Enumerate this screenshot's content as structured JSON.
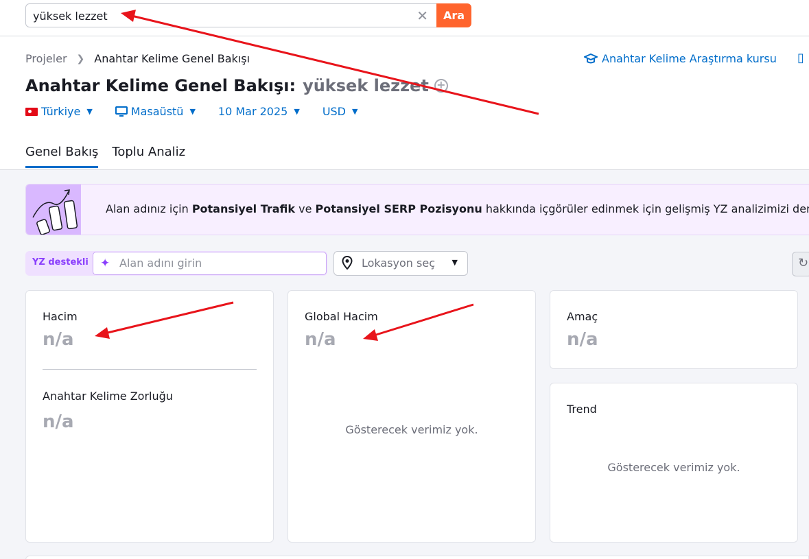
{
  "search": {
    "value": "yüksek lezzet",
    "button_label": "Ara"
  },
  "breadcrumb": {
    "root": "Projeler",
    "current": "Anahtar Kelime Genel Bakışı"
  },
  "course_link": "Anahtar Kelime Araştırma kursu",
  "title": {
    "prefix": "Anahtar Kelime Genel Bakışı:",
    "keyword": "yüksek lezzet"
  },
  "filters": {
    "country": "Türkiye",
    "device": "Masaüstü",
    "date": "10 Mar 2025",
    "currency": "USD"
  },
  "tabs": [
    {
      "label": "Genel Bakış"
    },
    {
      "label": "Toplu Analiz"
    }
  ],
  "banner": {
    "part1": "Alan adınız için ",
    "bold1": "Potansiyel Trafik",
    "part2": " ve ",
    "bold2": "Potansiyel SERP Pozisyonu",
    "part3": " hakkında içgörüler edinmek için gelişmiş YZ analizimizi den"
  },
  "ai": {
    "label": "YZ destekli",
    "placeholder": "Alan adını girin"
  },
  "location": {
    "placeholder": "Lokasyon seç"
  },
  "cards": {
    "volume": {
      "label": "Hacim",
      "value": "n/a"
    },
    "difficulty": {
      "label": "Anahtar Kelime Zorluğu",
      "value": "n/a"
    },
    "global_volume": {
      "label": "Global Hacim",
      "value": "n/a",
      "empty": "Gösterecek verimiz yok."
    },
    "intent": {
      "label": "Amaç",
      "value": "n/a"
    },
    "trend": {
      "label": "Trend",
      "empty": "Gösterecek verimiz yok."
    }
  },
  "colors": {
    "accent": "#006dca",
    "brand": "#ff642d",
    "annotation": "#e8141b",
    "ai": "#8a3ffc"
  }
}
